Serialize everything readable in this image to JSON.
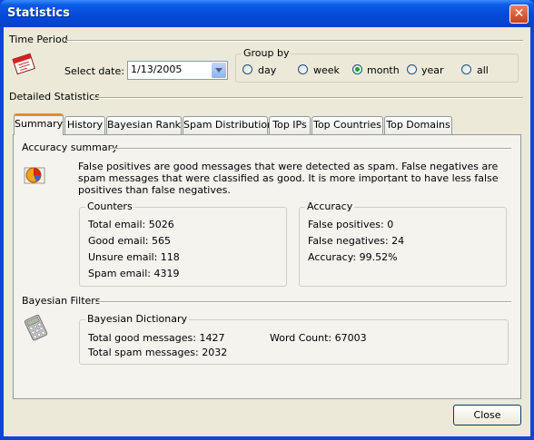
{
  "window": {
    "title": "Statistics",
    "close_glyph": "✕"
  },
  "time_period": {
    "label": "Time Period",
    "select_date_label": "Select date:",
    "date_value": "1/13/2005"
  },
  "group_by": {
    "label": "Group by",
    "options": [
      {
        "label": "day",
        "selected": false
      },
      {
        "label": "week",
        "selected": false
      },
      {
        "label": "month",
        "selected": true
      },
      {
        "label": "year",
        "selected": false
      },
      {
        "label": "all",
        "selected": false
      }
    ]
  },
  "detailed": {
    "label": "Detailed Statistics",
    "tabs": [
      {
        "label": "Summary",
        "active": true
      },
      {
        "label": "History"
      },
      {
        "label": "Bayesian Rank"
      },
      {
        "label": "Spam Distribution"
      },
      {
        "label": "Top IPs"
      },
      {
        "label": "Top Countries"
      },
      {
        "label": "Top Domains"
      }
    ]
  },
  "accuracy_summary": {
    "label": "Accuracy summary",
    "description": "False positives are good messages that were detected as spam. False negatives are spam messages that were classified as good. It is more important to have less false positives than false negatives.",
    "counters": {
      "label": "Counters",
      "total_email": "Total email: 5026",
      "good_email": "Good email: 565",
      "unsure_email": "Unsure email: 118",
      "spam_email": "Spam email: 4319"
    },
    "accuracy": {
      "label": "Accuracy",
      "false_positives": "False positives: 0",
      "false_negatives": "False negatives: 24",
      "accuracy": "Accuracy: 99.52%"
    }
  },
  "bayesian": {
    "label": "Bayesian Filters",
    "dictionary": {
      "label": "Bayesian Dictionary",
      "total_good": "Total good messages: 1427",
      "total_spam": "Total spam messages: 2032",
      "word_count": "Word Count: 67003"
    }
  },
  "footer": {
    "close_label": "Close"
  },
  "icons": {
    "calendar": "calendar-icon",
    "pie_chart": "pie-chart-icon",
    "calculator": "calculator-icon"
  }
}
